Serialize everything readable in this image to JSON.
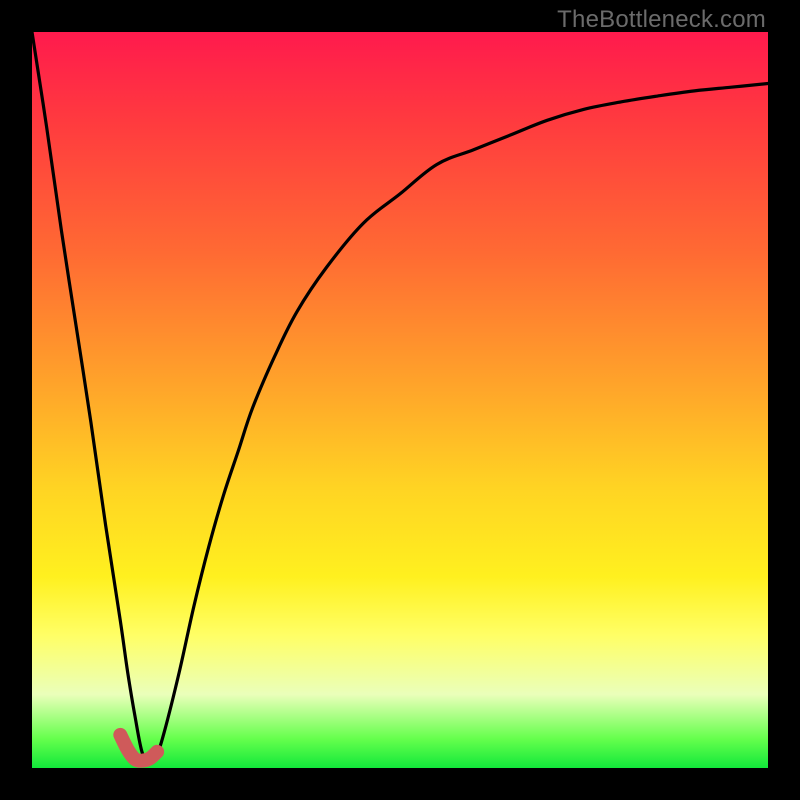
{
  "watermark": "TheBottleneck.com",
  "chart_data": {
    "type": "line",
    "title": "",
    "xlabel": "",
    "ylabel": "",
    "xlim": [
      0,
      100
    ],
    "ylim": [
      0,
      100
    ],
    "grid": false,
    "legend": false,
    "notes": "Bottleneck curve: descending spike from top-left to a minimum near x≈15, then a saturating rise approaching ~93 at the right edge. A short salmon segment highlights the minimum region (~x 12–17, y≈1–4).",
    "series": [
      {
        "name": "bottleneck-curve",
        "color": "#000000",
        "x": [
          0,
          2,
          4,
          6,
          8,
          10,
          12,
          13,
          14,
          15,
          16,
          17,
          18,
          20,
          22,
          24,
          26,
          28,
          30,
          33,
          36,
          40,
          45,
          50,
          55,
          60,
          65,
          70,
          75,
          80,
          85,
          90,
          95,
          100
        ],
        "y": [
          100,
          87,
          73,
          60,
          47,
          33,
          20,
          13,
          7,
          2,
          1,
          2,
          5,
          13,
          22,
          30,
          37,
          43,
          49,
          56,
          62,
          68,
          74,
          78,
          82,
          84,
          86,
          88,
          89.5,
          90.5,
          91.3,
          92,
          92.5,
          93
        ]
      },
      {
        "name": "highlight-minimum",
        "color": "#cf5a5a",
        "x": [
          12,
          13,
          14,
          15,
          16,
          17
        ],
        "y": [
          4.5,
          2.5,
          1.2,
          1.0,
          1.3,
          2.2
        ]
      }
    ]
  }
}
